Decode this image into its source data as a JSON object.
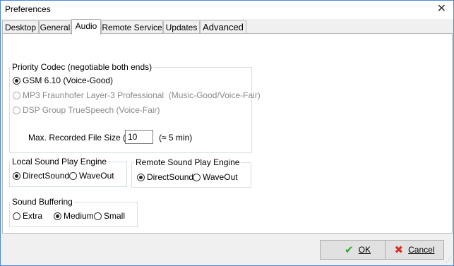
{
  "window": {
    "title": "Preferences",
    "close_symbol": "✕"
  },
  "tabs": [
    {
      "label": "Desktop",
      "active": false
    },
    {
      "label": "General",
      "active": false
    },
    {
      "label": "Audio",
      "active": true
    },
    {
      "label": "Remote Service",
      "active": false
    },
    {
      "label": "Updates",
      "active": false
    },
    {
      "label": "Advanced",
      "active": false
    }
  ],
  "codec": {
    "group_label": "Priority Codec (negotiable both ends)",
    "options": [
      {
        "label": "GSM 6.10 (Voice-Good)",
        "checked": true,
        "enabled": true
      },
      {
        "label": "MP3 Fraunhofer Layer-3 Professional  (Music-Good/Voice-Fair)",
        "checked": false,
        "enabled": false
      },
      {
        "label": "DSP Group TrueSpeech (Voice-Fair)",
        "checked": false,
        "enabled": false
      }
    ]
  },
  "max_file_size": {
    "label": "Max. Recorded File Size (MB):",
    "value": "10",
    "hint": "(≈ 5 min)"
  },
  "local_engine": {
    "group_label": "Local Sound Play Engine",
    "options": [
      {
        "label": "DirectSound",
        "checked": true
      },
      {
        "label": "WaveOut",
        "checked": false
      }
    ]
  },
  "remote_engine": {
    "group_label": "Remote Sound Play Engine",
    "options": [
      {
        "label": "DirectSound",
        "checked": true
      },
      {
        "label": "WaveOut",
        "checked": false
      }
    ]
  },
  "buffering": {
    "group_label": "Sound Buffering",
    "options": [
      {
        "label": "Extra",
        "checked": false
      },
      {
        "label": "Medium",
        "checked": true
      },
      {
        "label": "Small",
        "checked": false
      }
    ]
  },
  "buttons": {
    "ok": {
      "label": "OK",
      "icon": "checkmark-icon",
      "icon_glyph": "✔",
      "icon_color": "#2fa82f"
    },
    "cancel": {
      "label": "Cancel",
      "icon": "cross-icon",
      "icon_glyph": "✖",
      "icon_color": "#d83020"
    }
  }
}
